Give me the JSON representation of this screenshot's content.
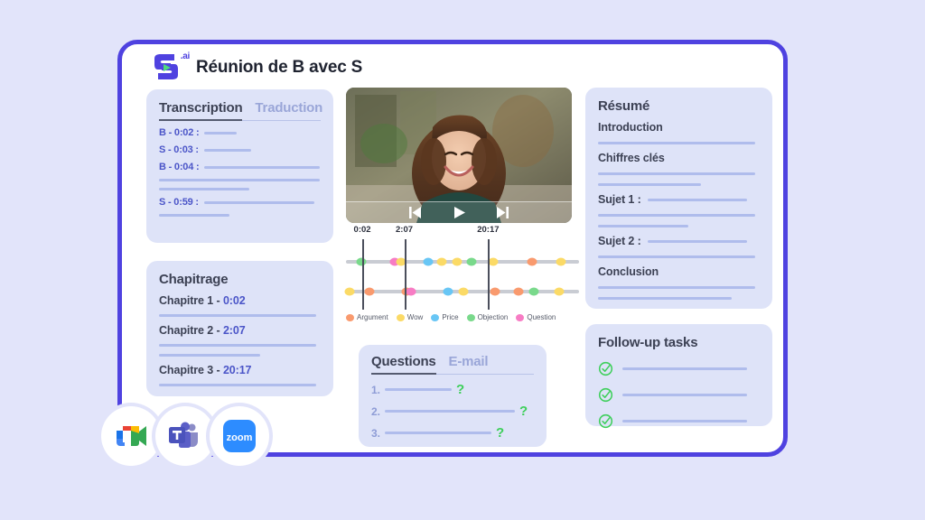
{
  "header": {
    "logo_name": "modjo-logo",
    "logo_suffix": ".ai",
    "title": "Réunion de B avec S"
  },
  "transcription": {
    "tabs": [
      {
        "label": "Transcription",
        "active": true
      },
      {
        "label": "Traduction",
        "active": false
      }
    ],
    "rows": [
      {
        "speaker": "B - 0:02 :",
        "line_width": 36
      },
      {
        "speaker": "S - 0:03 :",
        "line_width": 52
      },
      {
        "speaker": "B - 0:04 :",
        "line_width": 128
      },
      {
        "speaker": "",
        "line_width": 178
      },
      {
        "speaker": "",
        "line_width": 100
      },
      {
        "speaker": "S - 0:59 :",
        "line_width": 122
      },
      {
        "speaker": "",
        "line_width": 78
      }
    ]
  },
  "chapitrage": {
    "title": "Chapitrage",
    "chapters": [
      {
        "label": "Chapitre 1 - ",
        "time": "0:02",
        "lines": [
          174
        ]
      },
      {
        "label": "Chapitre 2 - ",
        "time": "2:07",
        "lines": [
          174,
          112
        ]
      },
      {
        "label": "Chapitre 3 - ",
        "time": "20:17",
        "lines": [
          174
        ]
      }
    ]
  },
  "video": {
    "name": "meeting-video-player",
    "controls": [
      {
        "name": "previous-button",
        "icon": "skip-back-icon"
      },
      {
        "name": "play-button",
        "icon": "play-icon"
      },
      {
        "name": "next-button",
        "icon": "skip-forward-icon"
      }
    ]
  },
  "chart_data": {
    "type": "scatter",
    "title": "",
    "xlabel": "",
    "ylabel": "",
    "markers": [
      {
        "time": "0:02",
        "x_pct": 7
      },
      {
        "time": "2:07",
        "x_pct": 25
      },
      {
        "time": "20:17",
        "x_pct": 61
      }
    ],
    "legend": [
      {
        "label": "Argument",
        "color": "#F99A6E"
      },
      {
        "label": "Wow",
        "color": "#FBDA66"
      },
      {
        "label": "Price",
        "color": "#68C6F5"
      },
      {
        "label": "Objection",
        "color": "#79D98B"
      },
      {
        "label": "Question",
        "color": "#F77CC4"
      }
    ],
    "series": [
      {
        "name": "row-1",
        "y_pct": 30,
        "points": [
          {
            "x_pct": 9,
            "category": "Objection"
          },
          {
            "x_pct": 29,
            "category": "Question"
          },
          {
            "x_pct": 33,
            "category": "Wow"
          },
          {
            "x_pct": 49,
            "category": "Price"
          },
          {
            "x_pct": 57,
            "category": "Wow"
          },
          {
            "x_pct": 66,
            "category": "Wow"
          },
          {
            "x_pct": 75,
            "category": "Objection"
          },
          {
            "x_pct": 88,
            "category": "Wow"
          },
          {
            "x_pct": 111,
            "category": "Argument"
          },
          {
            "x_pct": 128,
            "category": "Wow"
          }
        ]
      },
      {
        "name": "row-2",
        "y_pct": 72,
        "points": [
          {
            "x_pct": 2,
            "category": "Wow"
          },
          {
            "x_pct": 14,
            "category": "Argument"
          },
          {
            "x_pct": 36,
            "category": "Argument"
          },
          {
            "x_pct": 39,
            "category": "Question"
          },
          {
            "x_pct": 61,
            "category": "Price"
          },
          {
            "x_pct": 70,
            "category": "Wow"
          },
          {
            "x_pct": 89,
            "category": "Argument"
          },
          {
            "x_pct": 103,
            "category": "Argument"
          },
          {
            "x_pct": 112,
            "category": "Objection"
          },
          {
            "x_pct": 127,
            "category": "Wow"
          }
        ]
      }
    ]
  },
  "questions": {
    "tabs": [
      {
        "label": "Questions",
        "active": true
      },
      {
        "label": "E-mail",
        "active": false
      }
    ],
    "items": [
      {
        "num": "1.",
        "line_width": 74,
        "mark": "?"
      },
      {
        "num": "2.",
        "line_width": 144,
        "mark": "?"
      },
      {
        "num": "3.",
        "line_width": 118,
        "mark": "?"
      }
    ]
  },
  "resume": {
    "title": "Résumé",
    "sections": [
      {
        "head": "Introduction",
        "inline_line": 0,
        "lines": [
          174
        ]
      },
      {
        "head": "Chiffres clés",
        "inline_line": 0,
        "lines": [
          174,
          114
        ]
      },
      {
        "head": "Sujet 1 :",
        "inline_line": 110,
        "lines": [
          174,
          100
        ]
      },
      {
        "head": "Sujet 2 :",
        "inline_line": 110,
        "lines": [
          174
        ]
      },
      {
        "head": "Conclusion",
        "inline_line": 0,
        "lines": [
          174,
          148
        ]
      }
    ]
  },
  "followup": {
    "title": "Follow-up tasks",
    "tasks": [
      {
        "icon": "check-circle-icon",
        "line_width": 138
      },
      {
        "icon": "check-circle-icon",
        "line_width": 138
      },
      {
        "icon": "check-circle-icon",
        "line_width": 138
      }
    ]
  },
  "apps": [
    {
      "name": "google-meet-icon",
      "label": "Google Meet"
    },
    {
      "name": "microsoft-teams-icon",
      "label": "Microsoft Teams"
    },
    {
      "name": "zoom-icon",
      "label": "Zoom"
    }
  ],
  "colors": {
    "accent": "#4F42E0",
    "page_bg": "#E2E4FA",
    "panel_bg": "#DEE3F8",
    "line": "#AFBCEC",
    "green": "#3ECF5B"
  }
}
